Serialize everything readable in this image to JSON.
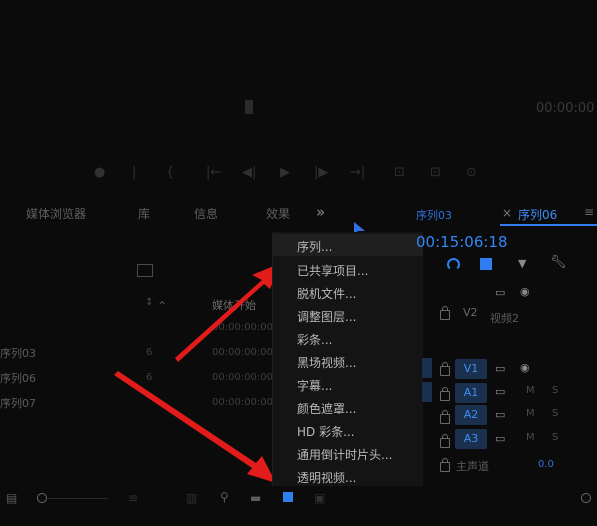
{
  "source_monitor": {
    "timecode": "00:00:00",
    "controls": [
      "●",
      "|",
      "{",
      "|←",
      "◀|",
      "▶",
      "|▶",
      "→|",
      "⊡",
      "⊡",
      "⊙"
    ]
  },
  "panel_tabs": {
    "t1": "媒体浏览器",
    "t2": "库",
    "t3": "信息",
    "t4": "效果",
    "more": "»"
  },
  "project": {
    "col_start": "媒体开始",
    "rows": [
      {
        "label": "序列03",
        "n": "6",
        "tc": "00:00:00:00"
      },
      {
        "label": "序列06",
        "n": "6",
        "tc": "00:00:00:00"
      },
      {
        "label": "序列07",
        "n": "",
        "tc": "00:00:00:00"
      }
    ],
    "extra_tc": "00:00:00:00"
  },
  "new_item_menu": {
    "items": [
      "序列...",
      "已共享项目...",
      "脱机文件...",
      "调整图层...",
      "彩条...",
      "黑场视频...",
      "字幕...",
      "颜色遮罩...",
      "HD 彩条...",
      "通用倒计时片头...",
      "透明视频..."
    ]
  },
  "timeline": {
    "tab_inactive": "序列03",
    "tab_close": "×",
    "tab_active": "序列06",
    "tab_menu": "≡",
    "timecode": "00:15:06:18",
    "tracks": {
      "v2": "V2",
      "video2_label": "视频2",
      "v1": "V1",
      "a1": "A1",
      "a2": "A2",
      "a3": "A3",
      "m": "M",
      "s": "S",
      "master": "主声道",
      "master_value": "0.0"
    }
  },
  "colors": {
    "accent": "#2f7ff0",
    "arrow": "#e21b1b",
    "track_fill": "#1b2f4e"
  }
}
